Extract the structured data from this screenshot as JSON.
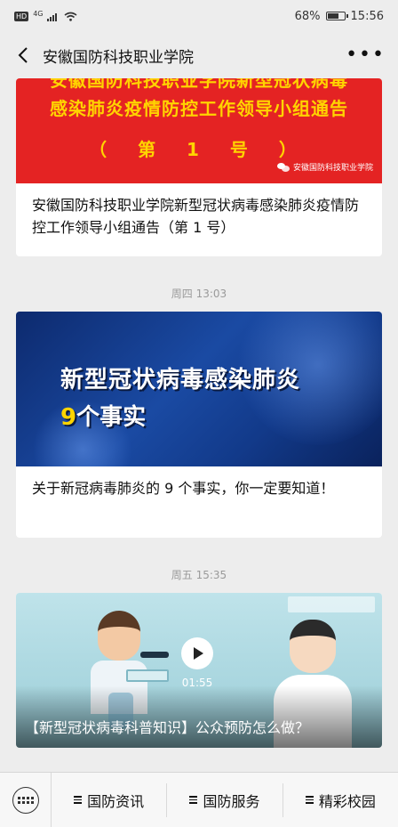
{
  "status_bar": {
    "hd": "HD",
    "network": "4G",
    "battery": "68%",
    "battery_level": 0.68,
    "time": "15:56"
  },
  "nav": {
    "title": "安徽国防科技职业学院",
    "back_icon": "chevron-left-icon",
    "more_icon": "more-dots-icon"
  },
  "articles": [
    {
      "banner_line1": "安徽国防科技职业学院新型冠状病毒",
      "banner_line2": "感染肺炎疫情防控工作领导小组通告",
      "banner_line3": "（ 第 1 号 ）",
      "watermark": "安徽国防科技职业学院",
      "title": "安徽国防科技职业学院新型冠状病毒感染肺炎疫情防控工作领导小组通告（第 1 号）"
    },
    {
      "time": "周四 13:03",
      "headline1": "新型冠状病毒感染肺炎",
      "headline2_num": "9",
      "headline2_rest": "个事实",
      "title": "关于新冠病毒肺炎的 9 个事实，你一定要知道！"
    },
    {
      "time": "周五 15:35",
      "duration": "01:55",
      "title": "【新型冠状病毒科普知识】公众预防怎么做？",
      "play_icon": "play-icon"
    }
  ],
  "bottom_menu": {
    "keyboard_icon": "keyboard-icon",
    "items": [
      {
        "label": "国防资讯"
      },
      {
        "label": "国防服务"
      },
      {
        "label": "精彩校园"
      }
    ]
  }
}
